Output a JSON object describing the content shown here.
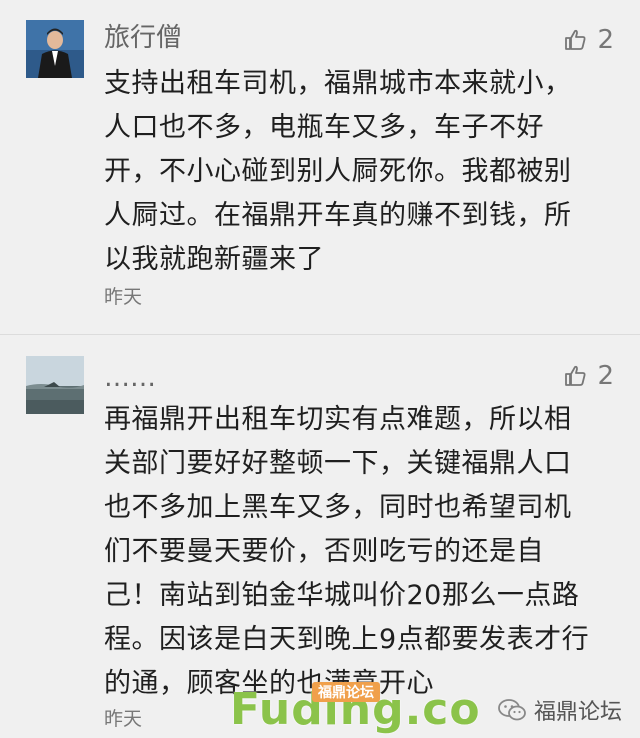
{
  "comments": [
    {
      "username": "旅行僧",
      "likes": "2",
      "text": "支持出租车司机，福鼎城市本来就小，\n人口也不多，电瓶车又多，车子不好\n开，不小心碰到别人屙死你。我都被别\n人屙过。在福鼎开车真的赚不到钱，所\n以我就跑新疆来了",
      "time": "昨天",
      "avatar_icon": "person-in-suit-icon"
    },
    {
      "username": "……",
      "likes": "2",
      "text": "再福鼎开出租车切实有点难题，所以相\n关部门要好好整顿一下，关键福鼎人口\n也不多加上黑车又多，同时也希望司机\n们不要曼天要价，否则吃亏的还是自\n己！南站到铂金华城叫价20那么一点路\n程。因该是白天到晚上9点都要发表才行\n的通，顾客坐的也满意开心",
      "time": "昨天",
      "avatar_icon": "sea-landscape-icon"
    }
  ],
  "watermark": {
    "text": "Fuding.co",
    "tag": "福鼎论坛"
  },
  "forum_badge": {
    "label": "福鼎论坛",
    "icon": "wechat-icon"
  },
  "colors": {
    "background": "#f0f0f0",
    "watermark_green": "#8bc34a",
    "watermark_tag": "#f0a04b"
  }
}
